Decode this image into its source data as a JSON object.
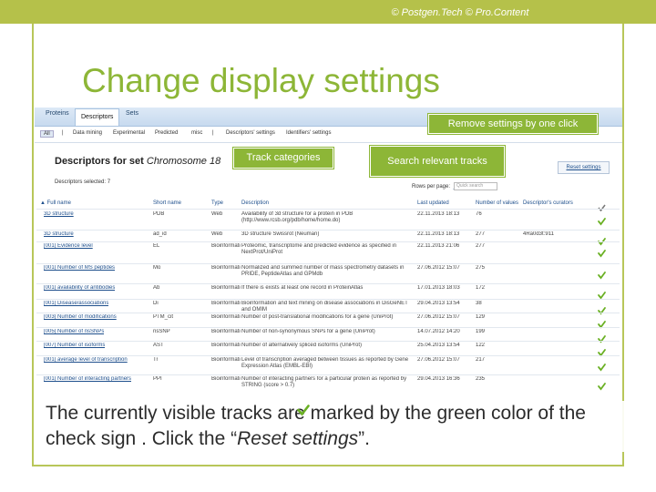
{
  "slide": {
    "copyright": "© Postgen.Tech © Pro.Content",
    "title": "Change display settings",
    "caption_part1": "The currently visible tracks are marked by the green color of the check sign ",
    "caption_part2": ". Click the “",
    "caption_italic": "Reset settings",
    "caption_part3": "”."
  },
  "callouts": {
    "remove": "Remove settings by one click",
    "track": "Track categories",
    "search": "Search relevant tracks"
  },
  "nav_tabs": [
    {
      "label": "Proteins"
    },
    {
      "label": "Descriptors",
      "active": true
    },
    {
      "label": "Sets"
    }
  ],
  "subnav": {
    "all": "All",
    "items": [
      "Data mining",
      "Experimental",
      "Predicted",
      "misc"
    ],
    "extra": [
      "Descriptors' settings",
      "Identifiers' settings"
    ]
  },
  "heading": {
    "prefix": "Descriptors for set ",
    "set_name": "Chromosome 18"
  },
  "reset_label": "Reset settings",
  "selected_text": "Descriptors selected: 7",
  "rows_per_page": {
    "label": "Rows per page:",
    "options": [
      "20",
      "50",
      "100"
    ]
  },
  "quick_search_placeholder": "Quick search",
  "columns": [
    "Full name",
    "Short name",
    "Type",
    "Description",
    "Last updated",
    "Number of values",
    "Descriptor's curators"
  ],
  "rows": [
    {
      "name": "3D structure",
      "short": "PDB",
      "type": "Web",
      "desc": "Availability of 3d structure for a protein in PDB (http://www.rcsb.org/pdb/home/home.do)",
      "updated": "22.11.2013 18:13",
      "count": "76",
      "curator": ""
    },
    {
      "name": "3D structure",
      "short": "ad_id",
      "type": "Web",
      "desc": "3D structure Swissrot (Neuman)",
      "updated": "22.11.2013 18:13",
      "count": "277",
      "curator": "4Ra0d3t:911"
    },
    {
      "name": "[001] Evidence level",
      "short": "EL",
      "type": "Bioinformatics",
      "desc": "Proteomic, transcriptome and predicted evidence as specified in NextProt/UniProt",
      "updated": "22.11.2013 21:06",
      "count": "277",
      "curator": ""
    },
    {
      "name": "[001] Number of MS peptides",
      "short": "Mo",
      "type": "Bioinformatics",
      "desc": "Normalized and summed number of mass spectrometry datasets in PRIDE, PeptideAtlas and GPMdb",
      "updated": "27.06.2012 15:07",
      "count": "275",
      "curator": ""
    },
    {
      "name": "[001] availability of antibodies",
      "short": "Ab",
      "type": "Bioinformatics",
      "desc": "If there is exists at least one record in ProteinAtlas",
      "updated": "17.01.2013 18:03",
      "count": "172",
      "curator": ""
    },
    {
      "name": "[001] Disease/associations",
      "short": "Di",
      "type": "Bioinformatics",
      "desc": "Bioinformation and text mining on disease associations in DisGeNET and OMIM",
      "updated": "29.04.2013 13:54",
      "count": "38",
      "curator": ""
    },
    {
      "name": "[003] Number of modifications",
      "short": "PTM_cit",
      "type": "Bioinformatics",
      "desc": "Number of post-translational modifications for a gene (UniProt)",
      "updated": "27.06.2012 15:07",
      "count": "129",
      "curator": ""
    },
    {
      "name": "[005] Number of nsSNPs",
      "short": "nsSNP",
      "type": "Bioinformatics",
      "desc": "Number of non-synonymous SNPs for a gene (UniProt)",
      "updated": "14.07.2012 14:20",
      "count": "199",
      "curator": ""
    },
    {
      "name": "[007] Number of isoforms",
      "short": "AST",
      "type": "Bioinformatics",
      "desc": "Number of alternatively spliced isoforms (UniProt)",
      "updated": "25.04.2013 13:54",
      "count": "122",
      "curator": ""
    },
    {
      "name": "[001] average level of transcription",
      "short": "Tr",
      "type": "Bioinformatics",
      "desc": "Level of transcription averaged between tissues as reported by Gene Expression Atlas (EMBL-EBI)",
      "updated": "27.06.2012 15:07",
      "count": "217",
      "curator": ""
    },
    {
      "name": "[001] Number of interacting partners",
      "short": "PPI",
      "type": "Bioinformatics",
      "desc": "Number of interacting partners for a particular protein as reported by STRING (score > 0.7)",
      "updated": "29.04.2013 16:36",
      "count": "235",
      "curator": ""
    }
  ],
  "colors": {
    "accent": "#8db637",
    "link": "#1e4f8c",
    "check": "#6ab023"
  }
}
